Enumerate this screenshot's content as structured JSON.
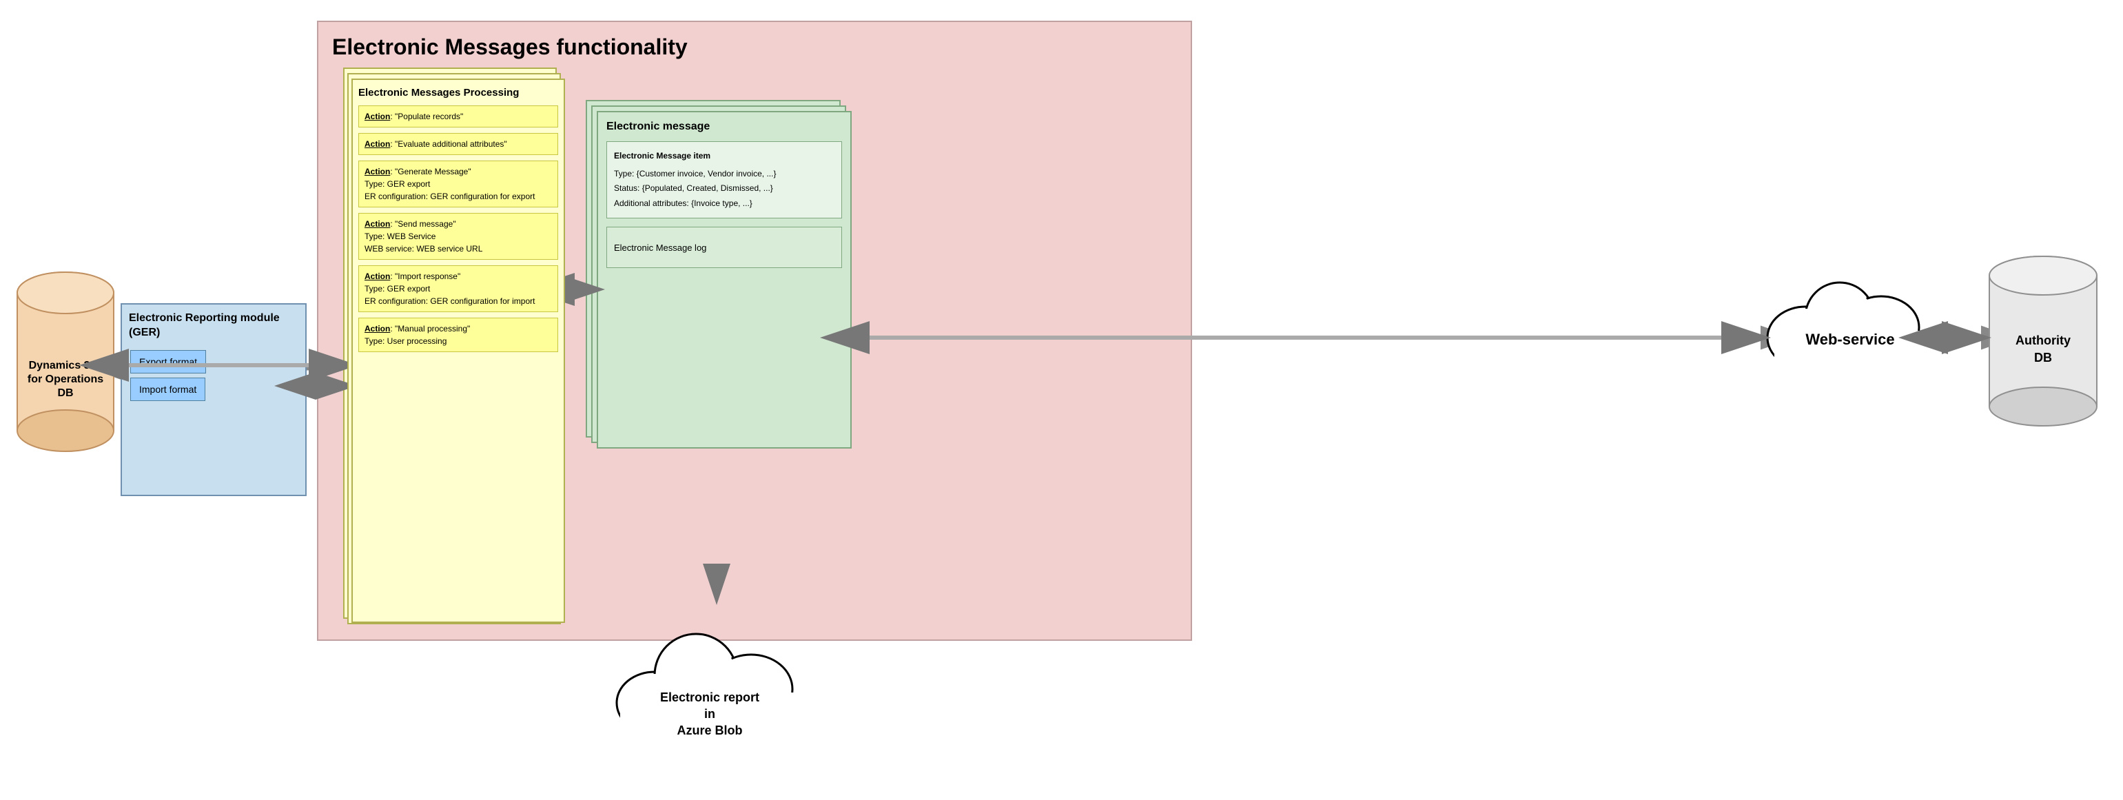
{
  "title": "Electronic Messages functionality",
  "emp": {
    "title": "Electronic Messages Processing",
    "actions": [
      {
        "label": "Action",
        "quote": "\"Populate records\""
      },
      {
        "label": "Action",
        "quote": "\"Evaluate additional attributes\""
      },
      {
        "label": "Action",
        "quote": "\"Generate Message\"",
        "detail1": "Type: GER export",
        "detail2": "ER configuration: GER configuration for export"
      },
      {
        "label": "Action",
        "quote": "\"Send message\"",
        "detail1": "Type: WEB Service",
        "detail2": "WEB service: WEB service URL"
      },
      {
        "label": "Action",
        "quote": "\"Import response\"",
        "detail1": "Type: GER export",
        "detail2": "ER configuration: GER configuration for import"
      },
      {
        "label": "Action",
        "quote": "\"Manual processing\"",
        "detail1": "Type: User processing"
      }
    ]
  },
  "er_module": {
    "title": "Electronic Reporting module (GER)",
    "export_format": "Export format",
    "import_format": "Import format"
  },
  "dynamics_db": {
    "label_line1": "Dynamics 365",
    "label_line2": "for Operations",
    "label_line3": "DB"
  },
  "em": {
    "title": "Electronic message",
    "item_title": "Electronic Message item",
    "type": "Type: {Customer invoice, Vendor invoice, ...}",
    "status": "Status: {Populated, Created, Dismissed, ...}",
    "additional": "Additional attributes: {Invoice type, ...}",
    "log_label": "Electronic Message log"
  },
  "webservice": {
    "label": "Web-service"
  },
  "authority_db": {
    "label_line1": "Authority",
    "label_line2": "DB"
  },
  "er_cloud": {
    "line1": "Electronic report",
    "line2": "in",
    "line3": "Azure Blob"
  },
  "colors": {
    "pink_bg": "#f2d0d0",
    "yellow_bg": "#ffffd0",
    "blue_bg": "#c8dff0",
    "green_bg": "#d0e8d0",
    "export_btn": "#99ccff",
    "import_btn": "#99ccff"
  }
}
